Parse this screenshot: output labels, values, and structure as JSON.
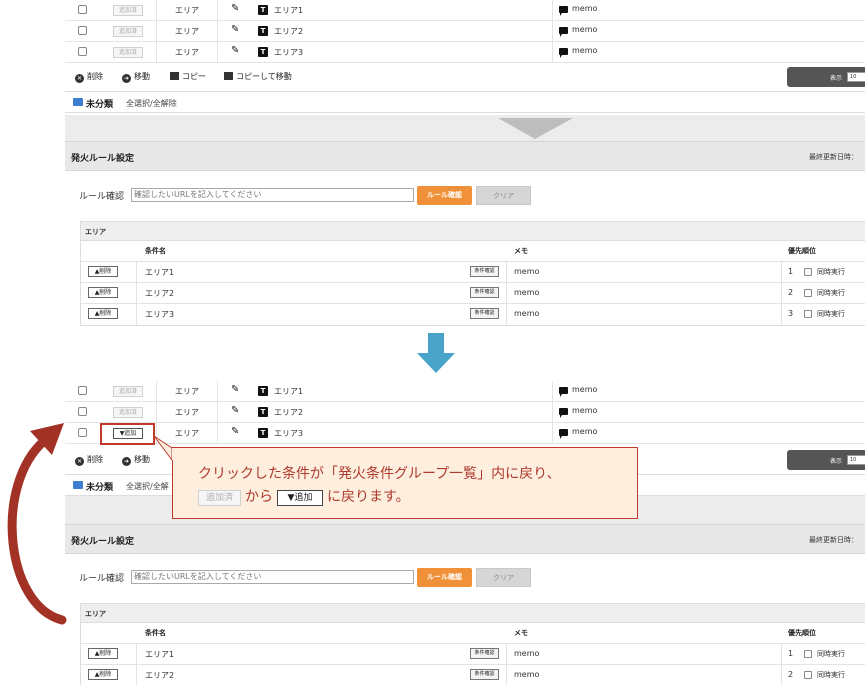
{
  "colors": {
    "accent_orange": "#f0913a",
    "callout_border": "#c0392b",
    "callout_bg": "#fdeede",
    "arrow_blue": "#4aa3c9",
    "curve_arrow": "#a33226"
  },
  "list": {
    "rows": [
      {
        "add_label": "追加済",
        "area": "エリア",
        "type_icon": "T",
        "name": "エリア1",
        "memo": "memo"
      },
      {
        "add_label": "追加済",
        "area": "エリア",
        "type_icon": "T",
        "name": "エリア2",
        "memo": "memo"
      },
      {
        "add_label": "追加済",
        "area": "エリア",
        "type_icon": "T",
        "name": "エリア3",
        "memo": "memo"
      }
    ],
    "after_rows": [
      {
        "add_label": "追加済",
        "area": "エリア",
        "type_icon": "T",
        "name": "エリア1",
        "memo": "memo"
      },
      {
        "add_label": "追加済",
        "area": "エリア",
        "type_icon": "T",
        "name": "エリア2",
        "memo": "memo"
      },
      {
        "add_label": "▼追加",
        "area": "エリア",
        "type_icon": "T",
        "name": "エリア3",
        "memo": "memo"
      }
    ],
    "toolbar": {
      "delete": "削除",
      "move": "移動",
      "copy": "コピー",
      "copy_move": "コピーして移動",
      "display": "表示",
      "per_page": "10"
    },
    "uncategorized": {
      "name": "未分類",
      "select_all": "全選択/全解除",
      "select_all_truncated": "全選択/全解"
    }
  },
  "rules": {
    "title": "発火ルール設定",
    "updated_label": "最終更新日時：",
    "check_label": "ルール確認",
    "url_placeholder": "確認したいURLを記入してください",
    "check_button": "ルール確認",
    "clear_button": "クリア",
    "group": {
      "title": "エリア",
      "headers": {
        "condition": "条件名",
        "memo": "メモ",
        "priority": "優先順位"
      },
      "rows": [
        {
          "delete_label": "▲削除",
          "name": "エリア1",
          "check_label": "条件確認",
          "memo": "memo",
          "priority": "1",
          "simultaneous": "同時実行"
        },
        {
          "delete_label": "▲削除",
          "name": "エリア2",
          "check_label": "条件確認",
          "memo": "memo",
          "priority": "2",
          "simultaneous": "同時実行"
        },
        {
          "delete_label": "▲削除",
          "name": "エリア3",
          "check_label": "条件確認",
          "memo": "memo",
          "priority": "3",
          "simultaneous": "同時実行"
        }
      ]
    }
  },
  "callout": {
    "line1": "クリックした条件が「発火条件グループ一覧」内に戻り、",
    "from_chip": "追加済",
    "from_text": "から",
    "to_chip": "▼追加",
    "to_text": "に戻ります。"
  }
}
